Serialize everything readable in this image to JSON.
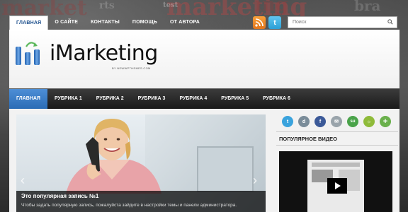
{
  "background": {
    "words": [
      "market",
      "marketing",
      "ing",
      "test",
      "rts",
      "bra"
    ]
  },
  "topnav": {
    "items": [
      {
        "label": "ГЛАВНАЯ",
        "active": true
      },
      {
        "label": "О САЙТЕ",
        "active": false
      },
      {
        "label": "КОНТАКТЫ",
        "active": false
      },
      {
        "label": "ПОМОЩЬ",
        "active": false
      },
      {
        "label": "ОТ АВТОРА",
        "active": false
      }
    ]
  },
  "social_top": [
    "rss-icon",
    "twitter-icon"
  ],
  "search": {
    "placeholder": "Поиск",
    "value": ""
  },
  "header": {
    "title": "iMarketing",
    "subtitle": "BY NEWWPTHEMES.COM"
  },
  "mainnav": {
    "items": [
      {
        "label": "ГЛАВНАЯ",
        "active": true
      },
      {
        "label": "РУБРИКА 1",
        "active": false
      },
      {
        "label": "РУБРИКА 2",
        "active": false
      },
      {
        "label": "РУБРИКА 3",
        "active": false
      },
      {
        "label": "РУБРИКА 4",
        "active": false
      },
      {
        "label": "РУБРИКА 5",
        "active": false
      },
      {
        "label": "РУБРИКА 6",
        "active": false
      }
    ]
  },
  "slider": {
    "title": "Это популярная запись №1",
    "excerpt": "Чтобы задать популярную запись, пожалуйста зайдите в настройки темы и панели администратора."
  },
  "sidebar": {
    "share_icons": [
      {
        "name": "twitter-icon",
        "glyph": "t",
        "color": "#3aa3dd"
      },
      {
        "name": "digg-icon",
        "glyph": "d",
        "color": "#7a8c99"
      },
      {
        "name": "facebook-icon",
        "glyph": "f",
        "color": "#3b5998"
      },
      {
        "name": "delicious-icon",
        "glyph": "✉",
        "color": "#9aa4ab"
      },
      {
        "name": "stumbleupon-icon",
        "glyph": "su",
        "color": "#4aa34a"
      },
      {
        "name": "technorati-icon",
        "glyph": "☼",
        "color": "#8fbb3a"
      },
      {
        "name": "add-icon",
        "glyph": "+",
        "color": "#6ab04c"
      }
    ],
    "popular_video_title": "ПОПУЛЯРНОЕ ВИДЕО"
  },
  "colors": {
    "accent": "#2b6cb5",
    "nav_dark": "#1a1a1a",
    "header_bg": "#ffffff"
  }
}
